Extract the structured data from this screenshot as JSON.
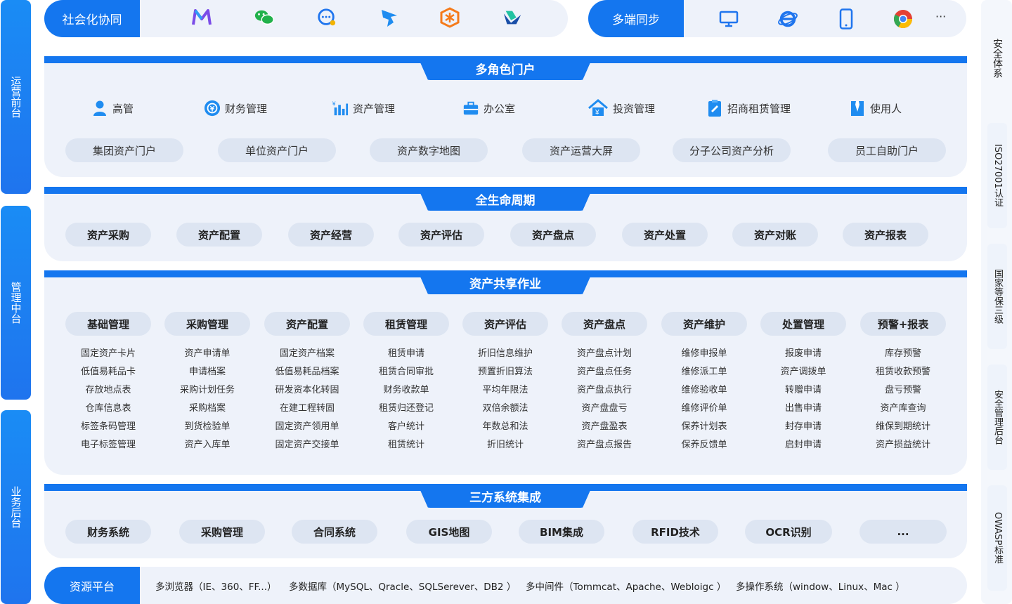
{
  "left_tabs": [
    "运营前台",
    "管理中台",
    "业务后台"
  ],
  "right_tabs": [
    "安全体系",
    "ISO27001认证",
    "国家等保三级",
    "安全管理后台",
    "OWASP标准"
  ],
  "social": {
    "label": "社会化协同",
    "icons": [
      "m-app-icon",
      "wechat-icon",
      "chat-bubble-icon",
      "dingtalk-icon",
      "cube-app-icon",
      "feishu-icon"
    ]
  },
  "multi": {
    "label": "多端同步",
    "icons": [
      "desktop-icon",
      "ie-browser-icon",
      "mobile-phone-icon",
      "chrome-icon"
    ],
    "more": "···"
  },
  "roles_section": {
    "title": "多角色门户",
    "roles": [
      {
        "label": "高管",
        "icon": "person-icon"
      },
      {
        "label": "财务管理",
        "icon": "finance-icon"
      },
      {
        "label": "资产管理",
        "icon": "bar-chart-yen-icon"
      },
      {
        "label": "办公室",
        "icon": "briefcase-icon"
      },
      {
        "label": "投资管理",
        "icon": "house-yen-icon"
      },
      {
        "label": "招商租赁管理",
        "icon": "clipboard-icon"
      },
      {
        "label": "使用人",
        "icon": "tie-person-icon"
      }
    ],
    "portals": [
      "集团资产门户",
      "单位资产门户",
      "资产数字地图",
      "资产运营大屏",
      "分子公司资产分析",
      "员工自助门户"
    ]
  },
  "lifecycle_section": {
    "title": "全生命周期",
    "items": [
      "资产采购",
      "资产配置",
      "资产经营",
      "资产评估",
      "资产盘点",
      "资产处置",
      "资产对账",
      "资产报表"
    ]
  },
  "shared_section": {
    "title": "资产共享作业",
    "columns": [
      {
        "title": "基础管理",
        "items": [
          "固定资产卡片",
          "低值易耗品卡",
          "存放地点表",
          "仓库信息表",
          "标签条码管理",
          "电子标签管理"
        ]
      },
      {
        "title": "采购管理",
        "items": [
          "资产申请单",
          "申请档案",
          "采购计划任务",
          "采购档案",
          "到货检验单",
          "资产入库单"
        ]
      },
      {
        "title": "资产配置",
        "items": [
          "固定资产档案",
          "低值易耗品档案",
          "研发资本化转固",
          "在建工程转固",
          "固定资产领用单",
          "固定资产交接单"
        ]
      },
      {
        "title": "租赁管理",
        "items": [
          "租赁申请",
          "租赁合同审批",
          "财务收款单",
          "租赁归还登记",
          "客户统计",
          "租赁统计"
        ]
      },
      {
        "title": "资产评估",
        "items": [
          "折旧信息维护",
          "预置折旧算法",
          "平均年限法",
          "双倍余额法",
          "年数总和法",
          "折旧统计"
        ]
      },
      {
        "title": "资产盘点",
        "items": [
          "资产盘点计划",
          "资产盘点任务",
          "资产盘点执行",
          "资产盘盘亏",
          "资产盘盈表",
          "资产盘点报告"
        ]
      },
      {
        "title": "资产维护",
        "items": [
          "维修申报单",
          "维修派工单",
          "维修验收单",
          "维修评价单",
          "保养计划表",
          "保养反馈单"
        ]
      },
      {
        "title": "处置管理",
        "items": [
          "报废申请",
          "资产调拨单",
          "转赠申请",
          "出售申请",
          "封存申请",
          "启封申请"
        ]
      },
      {
        "title": "预警+报表",
        "items": [
          "库存预警",
          "租赁收款预警",
          "盘亏预警",
          "资产库查询",
          "维保到期统计",
          "资产损益统计"
        ]
      }
    ]
  },
  "integration_section": {
    "title": "三方系统集成",
    "items": [
      "财务系统",
      "采购管理",
      "合同系统",
      "GIS地图",
      "BIM集成",
      "RFID技术",
      "OCR识别",
      "..."
    ]
  },
  "resource": {
    "label": "资源平台",
    "items": [
      "多浏览器（IE、360、FF...）",
      "多数据库（MySQL、Qracle、SQLSerever、DB2 ）",
      "多中间件（Tommcat、Apache、Webloigc ）",
      "多操作系统（window、Linux、Mac ）"
    ]
  },
  "colors": {
    "accent": "#1476ef",
    "panel": "#eef2fa",
    "chip": "#dde5f2"
  }
}
